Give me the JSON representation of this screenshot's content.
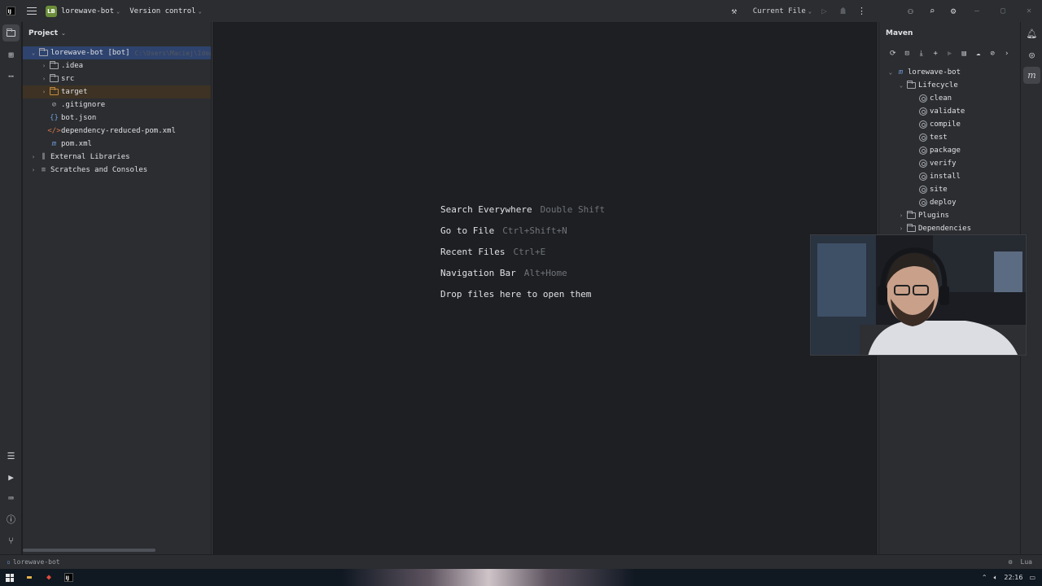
{
  "titlebar": {
    "project_badge": "LB",
    "project_name": "lorewave-bot",
    "vcs_label": "Version control",
    "run_config": "Current File"
  },
  "project_panel": {
    "title": "Project",
    "tree": [
      {
        "label": "lorewave-bot [bot]",
        "hint": "C:\\Users\\Maciej\\IdeaPro",
        "icon": "folder-icon"
      },
      {
        "label": ".idea",
        "icon": "folder-icon"
      },
      {
        "label": "src",
        "icon": "folder-icon"
      },
      {
        "label": "target",
        "icon": "folder-icon"
      },
      {
        "label": ".gitignore",
        "icon": "ignore-file-icon"
      },
      {
        "label": "bot.json",
        "icon": "json-file-icon"
      },
      {
        "label": "dependency-reduced-pom.xml",
        "icon": "xml-file-icon"
      },
      {
        "label": "pom.xml",
        "icon": "maven-file-icon"
      },
      {
        "label": "External Libraries",
        "icon": "library-icon"
      },
      {
        "label": "Scratches and Consoles",
        "icon": "scratches-icon"
      }
    ]
  },
  "editor": {
    "hints": [
      {
        "action": "Search Everywhere",
        "shortcut": "Double Shift"
      },
      {
        "action": "Go to File",
        "shortcut": "Ctrl+Shift+N"
      },
      {
        "action": "Recent Files",
        "shortcut": "Ctrl+E"
      },
      {
        "action": "Navigation Bar",
        "shortcut": "Alt+Home"
      },
      {
        "action": "Drop files here to open them",
        "shortcut": ""
      }
    ]
  },
  "maven_panel": {
    "title": "Maven",
    "root": "lorewave-bot",
    "lifecycle_label": "Lifecycle",
    "goals": [
      "clean",
      "validate",
      "compile",
      "test",
      "package",
      "verify",
      "install",
      "site",
      "deploy"
    ],
    "plugins_label": "Plugins",
    "dependencies_label": "Dependencies"
  },
  "statusbar": {
    "breadcrumb": "lorewave-bot",
    "language": "Lua"
  },
  "taskbar": {
    "time": "22:16"
  },
  "colors": {
    "background": "#1e1f22",
    "panel": "#2b2d30",
    "selection": "#2e436e",
    "project_badge": "#6b8e3a",
    "excluded_folder": "#c08a3e"
  }
}
